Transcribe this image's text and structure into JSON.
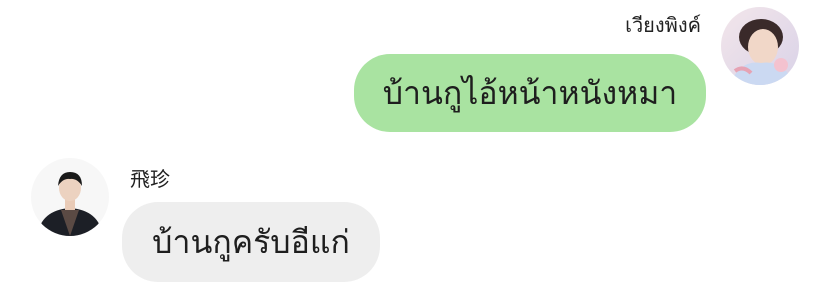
{
  "messages": [
    {
      "side": "right",
      "sender": "เวียงพิงค์",
      "text": "บ้านกูไอ้หน้าหนังหมา",
      "bubble_color": "#a9e3a1"
    },
    {
      "side": "left",
      "sender": "飛珍",
      "text": "บ้านกูครับอีแก่",
      "bubble_color": "#eeeeee"
    }
  ]
}
